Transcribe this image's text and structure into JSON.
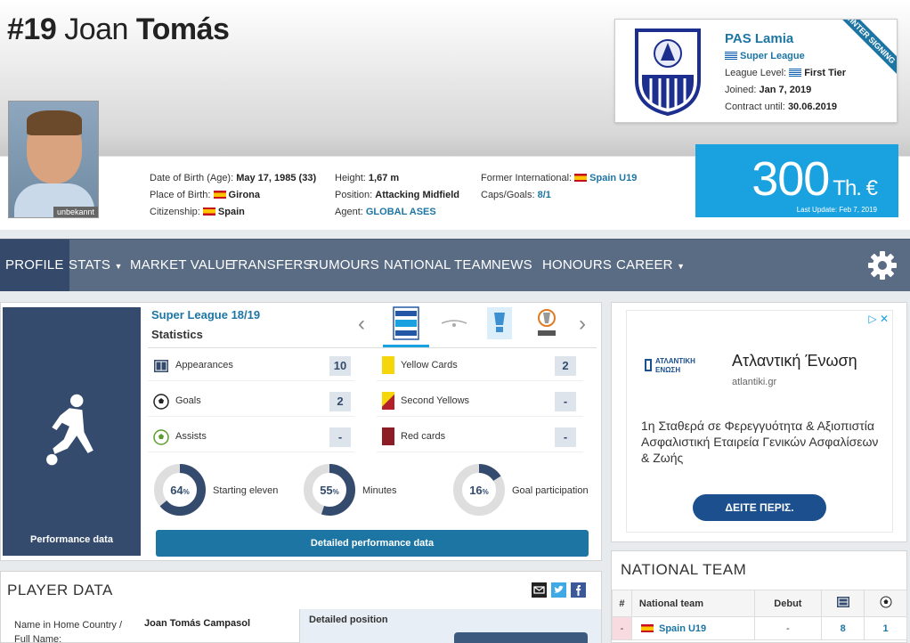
{
  "player": {
    "number": "#19",
    "first_name": "Joan",
    "last_name": "Tomás",
    "photo_caption": "unbekannt",
    "dob_label": "Date of Birth (Age):",
    "dob_value": "May 17, 1985 (33)",
    "pob_label": "Place of Birth:",
    "pob_value": "Girona",
    "citizenship_label": "Citizenship:",
    "citizenship_value": "Spain",
    "height_label": "Height:",
    "height_value": "1,67 m",
    "position_label": "Position:",
    "position_value": "Attacking Midfield",
    "agent_label": "Agent:",
    "agent_value": "GLOBAL ASES",
    "former_int_label": "Former International:",
    "former_int_value": "Spain U19",
    "caps_label": "Caps/Goals:",
    "caps_value": "8/1"
  },
  "club": {
    "name": "PAS Lamia",
    "league": "Super League",
    "league_level_label": "League Level:",
    "league_level_value": "First Tier",
    "joined_label": "Joined:",
    "joined_value": "Jan 7, 2019",
    "contract_label": "Contract until:",
    "contract_value": "30.06.2019",
    "ribbon": "WINTER SIGNING"
  },
  "market_value": {
    "value": "300",
    "unit": "Th. €",
    "last_update": "Last Update: Feb 7, 2019"
  },
  "nav": {
    "items": [
      "PROFILE",
      "STATS",
      "MARKET VALUE",
      "TRANSFERS",
      "RUMOURS",
      "NATIONAL TEAM",
      "NEWS",
      "HONOURS",
      "CAREER"
    ],
    "active": "PROFILE",
    "prev_arrow": "‹",
    "next_arrow": "›"
  },
  "performance": {
    "label": "Performance data",
    "competition": "Super League 18/19",
    "subtitle": "Statistics",
    "stats_left": [
      {
        "label": "Appearances",
        "value": "10"
      },
      {
        "label": "Goals",
        "value": "2"
      },
      {
        "label": "Assists",
        "value": "-"
      }
    ],
    "stats_right": [
      {
        "label": "Yellow Cards",
        "value": "2"
      },
      {
        "label": "Second Yellows",
        "value": "-"
      },
      {
        "label": "Red cards",
        "value": "-"
      }
    ],
    "donuts": [
      {
        "label": "Starting eleven",
        "display": "64",
        "pct_sign": "%",
        "fraction": 0.64
      },
      {
        "label": "Minutes",
        "display": "55",
        "pct_sign": "%",
        "fraction": 0.55
      },
      {
        "label": "Goal participation",
        "display": "16",
        "pct_sign": "%",
        "fraction": 0.16
      }
    ],
    "button": "Detailed performance data"
  },
  "ad": {
    "close": "▷ ✕",
    "brand": "ΑΤΛΑΝΤΙΚΗ ΕΝΩΣΗ",
    "title": "Ατλαντική Ένωση",
    "url": "atlantiki.gr",
    "body": "1η Σταθερά σε Φερεγγυότητα & Αξιοπιστία Ασφαλιστική Εταιρεία Γενικών Ασφαλίσεων & Ζωής",
    "cta": "ΔΕΙΤΕ ΠΕΡΙΣ."
  },
  "national_team": {
    "title": "NATIONAL TEAM",
    "headers": {
      "num": "#",
      "team": "National team",
      "debut": "Debut"
    },
    "rows": [
      {
        "num": "-",
        "team": "Spain U19",
        "debut": "-",
        "caps": "8",
        "goals": "1"
      }
    ]
  },
  "player_data": {
    "title": "PLAYER DATA",
    "name_label": "Name in Home Country / Full Name:",
    "name_value": "Joan Tomás Campasol",
    "detailed_position": "Detailed position"
  },
  "colors": {
    "nav_bg": "#5a6b84",
    "nav_active": "#354a6b",
    "accent": "#1d75a3",
    "market_value_bg": "#1aa1e0",
    "perf_dark": "#344b6d"
  }
}
